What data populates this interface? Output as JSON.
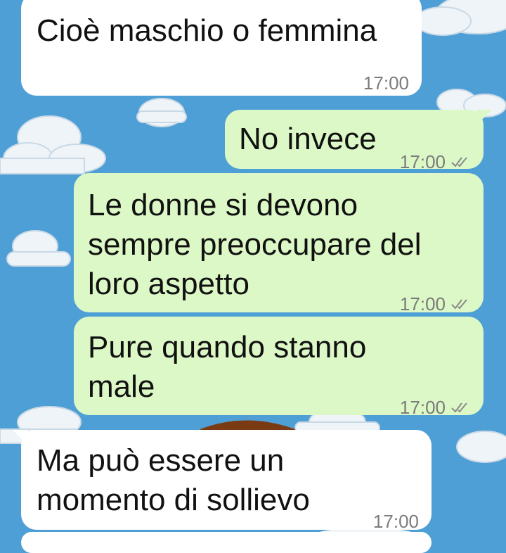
{
  "messages": [
    {
      "text": "Cioè maschio o femmina",
      "time": "17:00",
      "direction": "incoming"
    },
    {
      "text": "No invece",
      "time": "17:00",
      "direction": "outgoing",
      "read_status": "double-tick-icon"
    },
    {
      "text": "Le donne si devono\nsempre preoccupare del\nloro aspetto",
      "time": "17:00",
      "direction": "outgoing",
      "read_status": "double-tick-icon"
    },
    {
      "text": "Pure quando stanno\nmale",
      "time": "17:00",
      "direction": "outgoing",
      "read_status": "double-tick-icon"
    },
    {
      "text": "Ma può essere un\nmomento di sollievo",
      "time": "17:00",
      "direction": "incoming"
    }
  ],
  "colors": {
    "wallpaper": "#4e9fd6",
    "incoming_bubble": "#ffffff",
    "outgoing_bubble": "#dcf8c6",
    "timestamp": "#7b7b7b"
  }
}
